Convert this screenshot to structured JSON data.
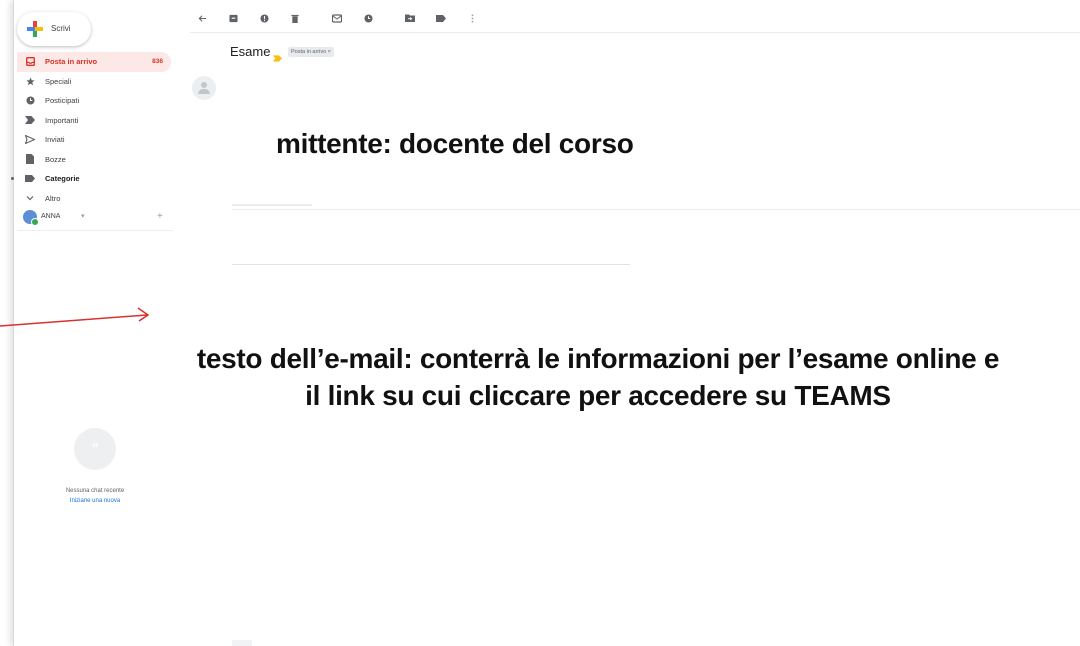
{
  "compose": {
    "label": "Scrivi"
  },
  "sidebar": {
    "items": [
      {
        "label": "Posta in arrivo",
        "icon": "inbox-icon",
        "count": "836",
        "active": true
      },
      {
        "label": "Speciali",
        "icon": "star-icon"
      },
      {
        "label": "Posticipati",
        "icon": "clock-icon"
      },
      {
        "label": "Importanti",
        "icon": "important-icon"
      },
      {
        "label": "Inviati",
        "icon": "send-icon"
      },
      {
        "label": "Bozze",
        "icon": "draft-icon"
      },
      {
        "label": "Categorie",
        "icon": "label-icon",
        "bold": true
      },
      {
        "label": "Altro",
        "icon": "chevron-down-icon"
      }
    ]
  },
  "account": {
    "name": "ANNA",
    "add": "+"
  },
  "hangouts": {
    "empty_text": "Nessuna chat recente",
    "new_link": "Iniziane una nuova"
  },
  "email": {
    "subject": "Esame",
    "inbox_chip": "Posta in arrivo ×"
  },
  "annotations": {
    "sender_caption": "mittente: docente del corso",
    "body_line1": "testo dell’e-mail: conterrà le informazioni per l’esame online e",
    "body_line2": "il link su cui cliccare per accedere su TEAMS"
  },
  "colors": {
    "accent_red": "#d93025",
    "active_bg": "#fce8e6",
    "arrow": "#d9312b",
    "link_blue": "#1a73e8"
  }
}
